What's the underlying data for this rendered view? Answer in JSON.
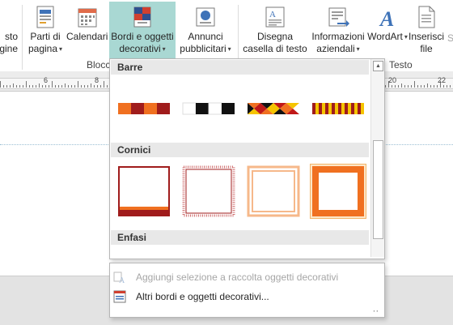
{
  "ribbon": {
    "buttons": [
      {
        "line1": "sto",
        "line2": "gine"
      },
      {
        "line1": "Parti di",
        "line2": "pagina",
        "caret": "▾"
      },
      {
        "line1": "Calendari",
        "caret": "▾"
      },
      {
        "line1": "Bordi e oggetti",
        "line2": "decorativi",
        "caret": "▾"
      },
      {
        "line1": "Annunci",
        "line2": "pubblicitari",
        "caret": "▾"
      },
      {
        "line1": "Disegna",
        "line2": "casella di testo"
      },
      {
        "line1": "Informazioni",
        "line2": "aziendali",
        "caret": "▾"
      },
      {
        "line1": "WordArt",
        "caret": "▾"
      },
      {
        "line1": "Inserisci",
        "line2": "file"
      }
    ],
    "groups": {
      "blocks": "Blocc",
      "text": "Testo"
    },
    "edge_text": "Si"
  },
  "ruler": {
    "numbers": [
      "6",
      "8",
      "20",
      "22"
    ]
  },
  "gallery": {
    "sections": [
      {
        "title": "Barre"
      },
      {
        "title": "Cornici"
      },
      {
        "title": "Enfasi"
      }
    ]
  },
  "menu": {
    "items": [
      {
        "label": "Aggiungi selezione a raccolta oggetti decorativi",
        "disabled": true
      },
      {
        "label": "Altri bordi e oggetti decorativi..."
      }
    ]
  },
  "colors": {
    "accent_selected": "#a9d8d3",
    "frame_dark": "#a01c1c",
    "frame_orange": "#f07020"
  }
}
